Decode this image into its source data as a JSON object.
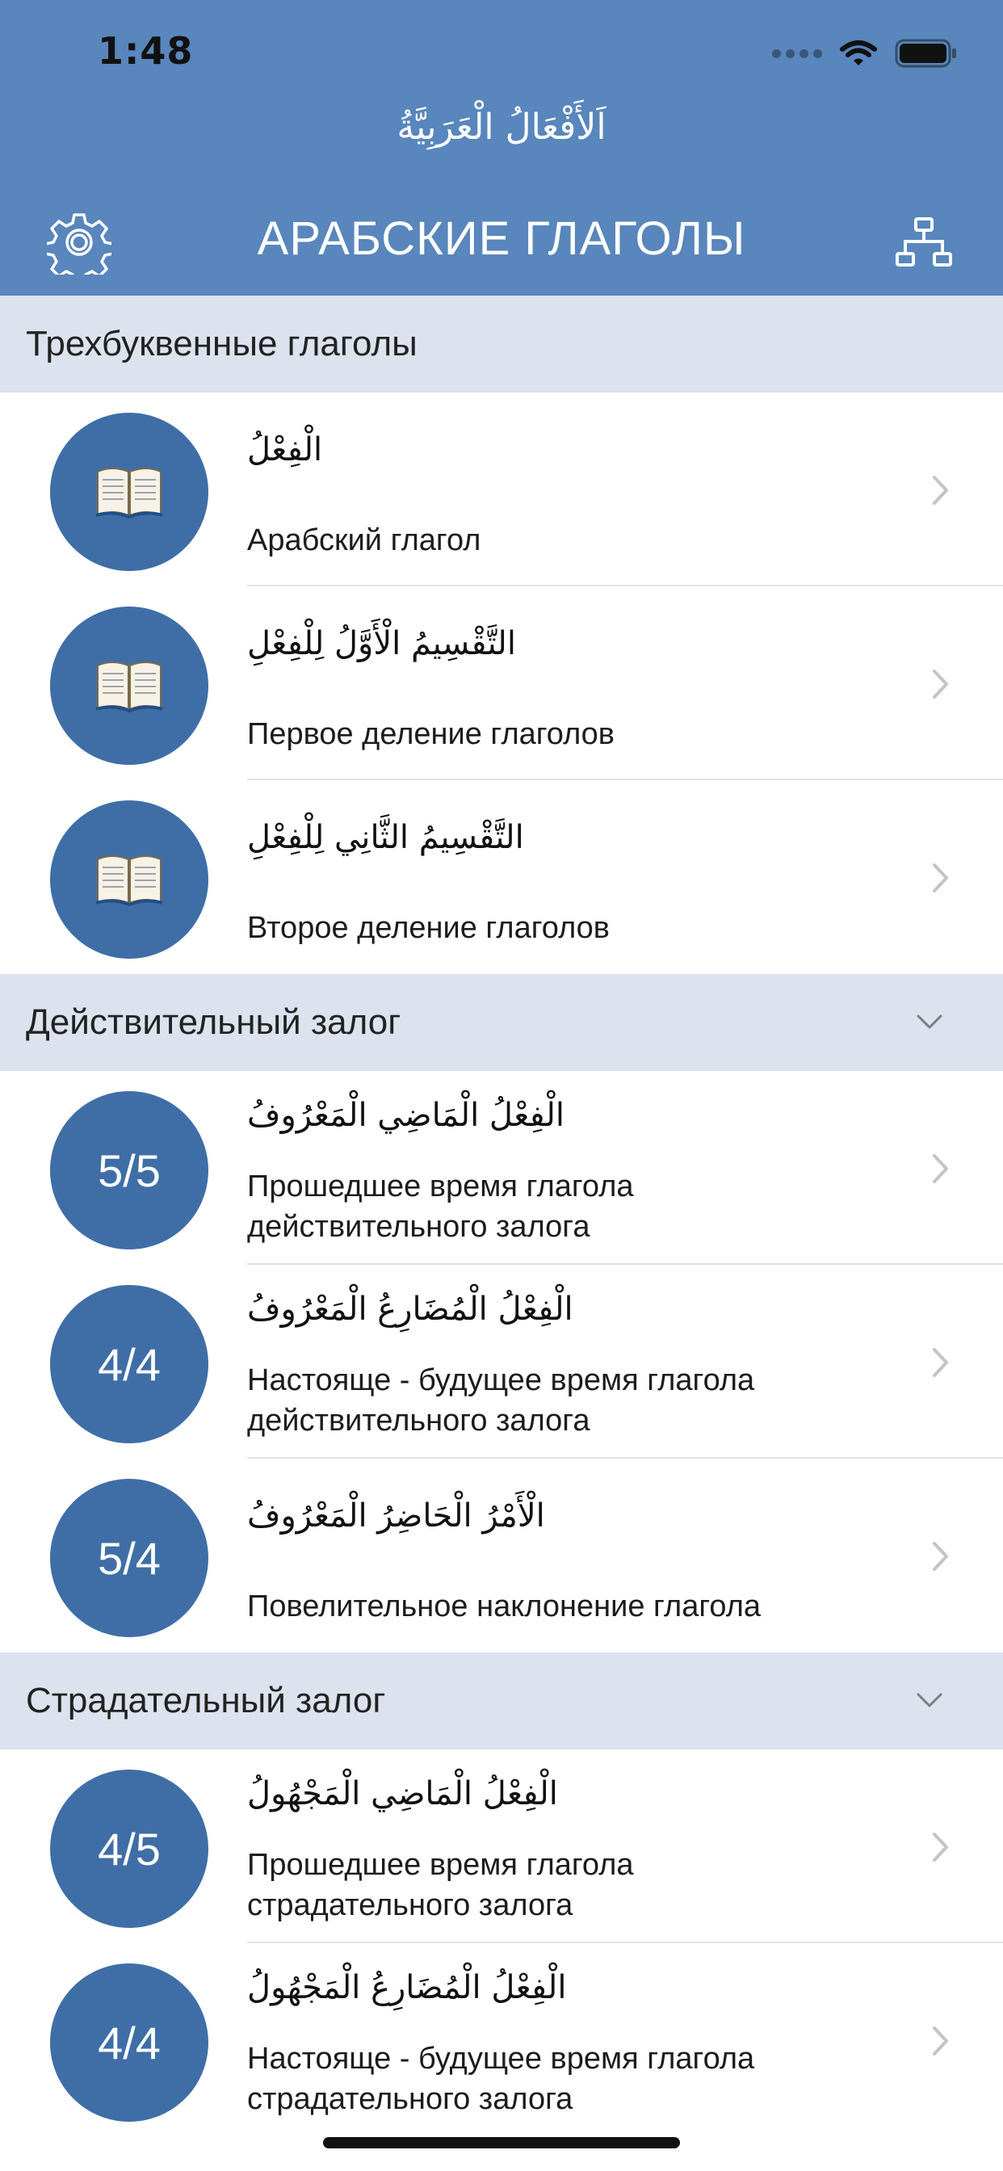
{
  "status_bar": {
    "time": "1:48"
  },
  "header": {
    "arabic_title": "اَلأَفْعَالُ الْعَرَبِيَّةُ",
    "title": "АРАБСКИЕ ГЛАГОЛЫ",
    "left_icon": "gear-icon",
    "right_icon": "hierarchy-icon"
  },
  "colors": {
    "header_bg": "#5886bd",
    "circle_bg": "#3f6ea7",
    "section_bg": "#dce3ee"
  },
  "sections": [
    {
      "title": "Трехбуквенные глаголы",
      "collapsible": false,
      "items": [
        {
          "badge_icon": "book-icon",
          "arabic": "الْفِعْلُ",
          "russian": "Арабский глагол"
        },
        {
          "badge_icon": "book-icon",
          "arabic": "التَّقْسِيمُ الْأَوَّلُ لِلْفِعْلِ",
          "russian": "Первое деление глаголов"
        },
        {
          "badge_icon": "book-icon",
          "arabic": "التَّقْسِيمُ الثَّانِي لِلْفِعْلِ",
          "russian": "Второе деление глаголов"
        }
      ]
    },
    {
      "title": "Действительный залог",
      "collapsible": true,
      "items": [
        {
          "badge": "5/5",
          "arabic": "الْفِعْلُ الْمَاضِي الْمَعْرُوفُ",
          "russian_1": "Прошедшее время глагола",
          "russian_2": "действительного залога"
        },
        {
          "badge": "4/4",
          "arabic": "الْفِعْلُ الْمُضَارِعُ الْمَعْرُوفُ",
          "russian_1": "Настояще - будущее время глагола",
          "russian_2": "действительного залога"
        },
        {
          "badge": "5/4",
          "arabic": "الْأَمْرُ الْحَاضِرُ الْمَعْرُوفُ",
          "russian": "Повелительное наклонение глагола"
        }
      ]
    },
    {
      "title": "Страдательный залог",
      "collapsible": true,
      "items": [
        {
          "badge": "4/5",
          "arabic": "الْفِعْلُ الْمَاضِي الْمَجْهُولُ",
          "russian_1": "Прошедшее время глагола",
          "russian_2": "страдательного залога"
        },
        {
          "badge": "4/4",
          "arabic": "الْفِعْلُ الْمُضَارِعُ الْمَجْهُولُ",
          "russian_1": "Настояще - будущее время глагола",
          "russian_2": "страдательного залога"
        }
      ]
    }
  ]
}
